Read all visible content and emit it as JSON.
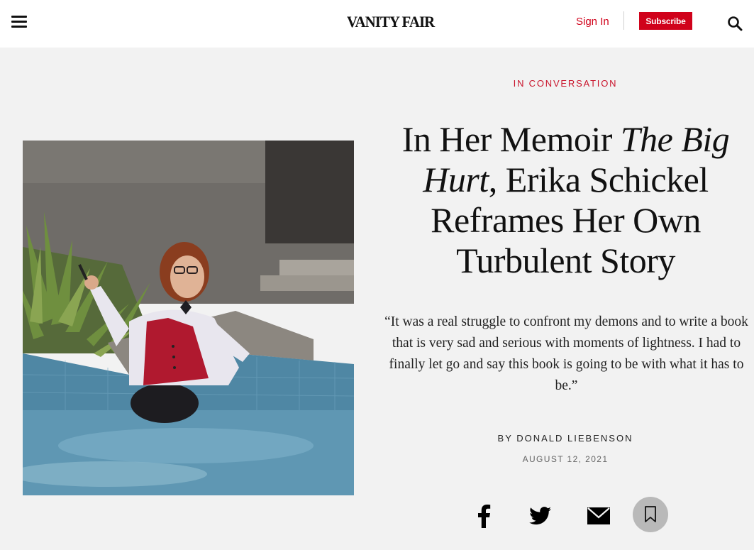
{
  "header": {
    "logo_text": "VANITY FAIR",
    "sign_in_label": "Sign In",
    "subscribe_label": "Subscribe",
    "accent_color": "#d0021b"
  },
  "article": {
    "rubric": "IN CONVERSATION",
    "headline": {
      "part1": "In Her Memoir ",
      "italic": "The Big Hurt",
      "part2": ", Erika Schickel Reframes Her Own Turbulent Story"
    },
    "dek": "“It was a real struggle to confront my demons and to write a book that is very sad and serious with moments of lightness. I had to finally let go and say this book is going to be with what it has to be.”",
    "byline_prefix": "BY ",
    "author": "DONALD LIEBENSON",
    "date": "AUGUST 12, 2021"
  },
  "icons": {
    "menu": "menu-icon",
    "search": "search-icon",
    "facebook": "facebook-icon",
    "twitter": "twitter-icon",
    "email": "email-icon",
    "bookmark": "bookmark-icon"
  }
}
